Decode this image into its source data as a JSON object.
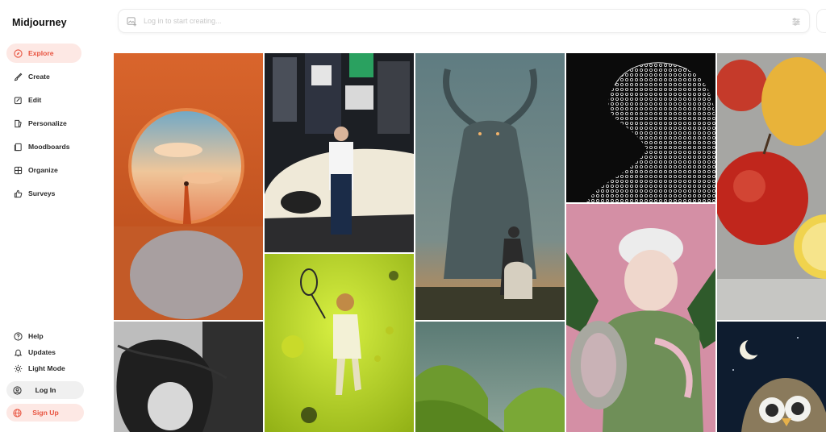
{
  "app": {
    "name": "Midjourney"
  },
  "nav": {
    "items": [
      {
        "label": "Explore",
        "icon": "compass-icon",
        "active": true
      },
      {
        "label": "Create",
        "icon": "brush-icon",
        "active": false
      },
      {
        "label": "Edit",
        "icon": "edit-icon",
        "active": false
      },
      {
        "label": "Personalize",
        "icon": "personalize-icon",
        "active": false
      },
      {
        "label": "Moodboards",
        "icon": "moodboard-icon",
        "active": false
      },
      {
        "label": "Organize",
        "icon": "grid-icon",
        "active": false
      },
      {
        "label": "Surveys",
        "icon": "thumbs-up-icon",
        "active": false
      }
    ]
  },
  "footer": {
    "help": "Help",
    "updates": "Updates",
    "light_mode": "Light Mode",
    "login": "Log In",
    "signup": "Sign Up"
  },
  "search": {
    "placeholder": "Log in to start creating..."
  },
  "gallery": {
    "images": [
      "portal-desert-woman",
      "street-car-girl",
      "horned-giant-knight",
      "lace-leopard",
      "red-apples-lemons",
      "bw-wind-portrait",
      "tennis-kid-green",
      "green-hills",
      "pink-beetle-child",
      "night-owl-moon"
    ]
  },
  "colors": {
    "accent": "#e8533f",
    "accent_bg": "#fde8e4"
  }
}
